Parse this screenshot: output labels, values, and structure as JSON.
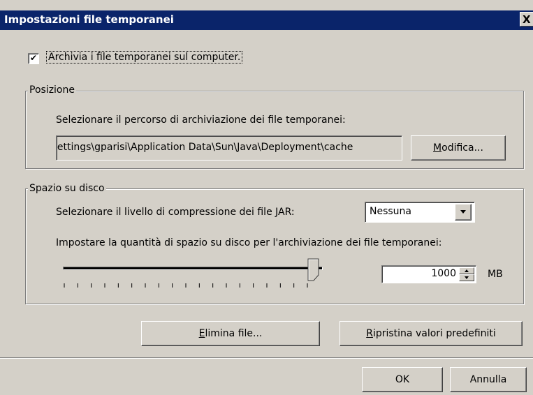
{
  "window": {
    "title": "Impostazioni file temporanei",
    "close_label": "X"
  },
  "archive_checkbox": {
    "checked_glyph": "✔",
    "label": "Archivia i file temporanei sul computer."
  },
  "position": {
    "group_label": "Posizione",
    "description": "Selezionare il percorso di archiviazione dei file temporanei:",
    "path_value": "iettings\\gparisi\\Application Data\\Sun\\Java\\Deployment\\cache",
    "modify_button": {
      "accel": "M",
      "rest": "odifica..."
    }
  },
  "disk_space": {
    "group_label": "Spazio su disco",
    "compression_label": "Selezionare il livello di compressione dei file JAR:",
    "compression_value": "Nessuna",
    "space_label": "Impostare la quantità di spazio su disco per l'archiviazione dei file temporanei:",
    "slider_level": 1.0,
    "space_value": "1000",
    "unit": "MB"
  },
  "actions": {
    "delete_button": {
      "accel": "E",
      "rest": "limina file..."
    },
    "restore_button": {
      "accel": "R",
      "rest": "ipristina valori predefiniti"
    }
  },
  "footer": {
    "ok_label": "OK",
    "cancel_label": "Annulla"
  },
  "colors": {
    "titlebar": "#0a246a",
    "face": "#d4d0c8"
  }
}
